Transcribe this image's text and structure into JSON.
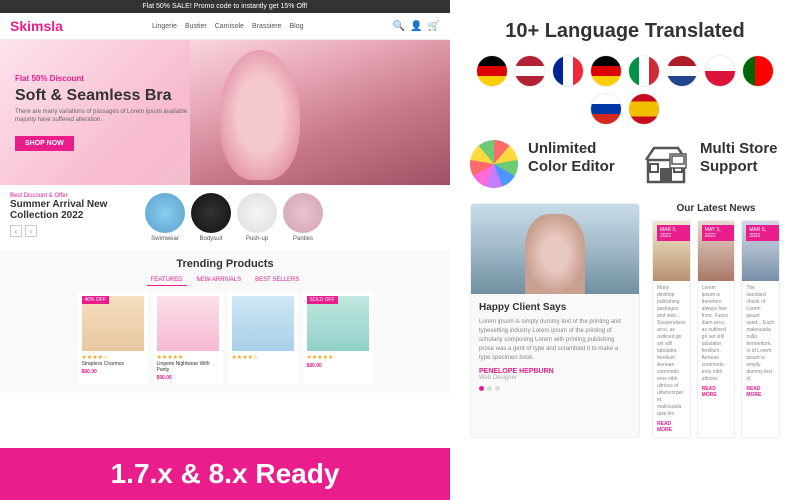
{
  "left": {
    "promo_bar": "Flat 50% SALE! Promo code to instantly get 15% Off!",
    "logo": "Skimsla",
    "nav_items": [
      "Lingerie",
      "Bustier",
      "Camisole",
      "Brassiere",
      "Blog"
    ],
    "hero": {
      "discount": "Flat 50% Discount",
      "title": "Soft & Seamless Bra",
      "subtitle": "There are many variations of passages of Lorem ipsum available majority have suffered alteration.",
      "button": "SHOP NOW"
    },
    "collection": {
      "label": "Best Discount & Offer",
      "title": "Summer Arrival New Collection 2022",
      "items": [
        "Swimwear",
        "Bodysuit",
        "Push-up",
        "Panties"
      ]
    },
    "trending": {
      "title": "Trending Products",
      "tabs": [
        "FEATURED",
        "NEW ARRIVALS",
        "BEST SELLERS"
      ],
      "products": [
        {
          "badge": "40% OFF",
          "name": "Strapless Charmos",
          "price": "$80.00"
        },
        {
          "badge": "",
          "name": "Lingerie Nightwear With Panty",
          "price": "$90.00"
        },
        {
          "badge": "",
          "name": "",
          "price": ""
        },
        {
          "badge": "SOLD OFF",
          "name": "",
          "price": "$80.00"
        }
      ]
    },
    "version_badge": "1.7.x & 8.x Ready"
  },
  "right": {
    "language_title": "10+ Language Translated",
    "flags": [
      "🇩🇪",
      "🇺🇸",
      "🇫🇷",
      "🇩🇪",
      "🇮🇹",
      "🇳🇱",
      "🇵🇱",
      "🇵🇹",
      "🇷🇺",
      "🇪🇸"
    ],
    "features": [
      {
        "icon": "color-wheel",
        "title": "Unlimited Color Editor"
      },
      {
        "icon": "store",
        "title": "Multi Store Support"
      }
    ],
    "client": {
      "section_title": "Happy Client Says",
      "text": "Lorem ipsum is simply dummy text of the printing and typesetting industry Lorem ipsum of the printing of scholarly composing Lorem with printing publishing prose was a gent of type and scrambled it to make a type specimen book.",
      "name": "PENELOPE HEPBURN",
      "role": "Web Designer"
    },
    "news": {
      "title": "Our Latest News",
      "articles": [
        {
          "date": "MAR 5, 2022",
          "text": "Many desktop publishing packages and web... Suspendisse arcu, as outlined go set still tabulator. ferellum. Aenean commodo eros nibh ultrices et ullamcorper et, malesuada quis leo."
        },
        {
          "date": "MAY 3, 2022",
          "text": "Lorem ipsum is therefore always free from. Fusce diam arcu, as outlined go set still tabulator. ferellum. Aenean commodo eros nibh ultrices."
        },
        {
          "date": "MAR 5, 2022",
          "text": "The standard chunk of Lorem ipsum used... Each malesuada nulla fermentum, In id Lorem ipsum is simply dummy text of."
        }
      ],
      "read_more": "READ MORE"
    }
  }
}
